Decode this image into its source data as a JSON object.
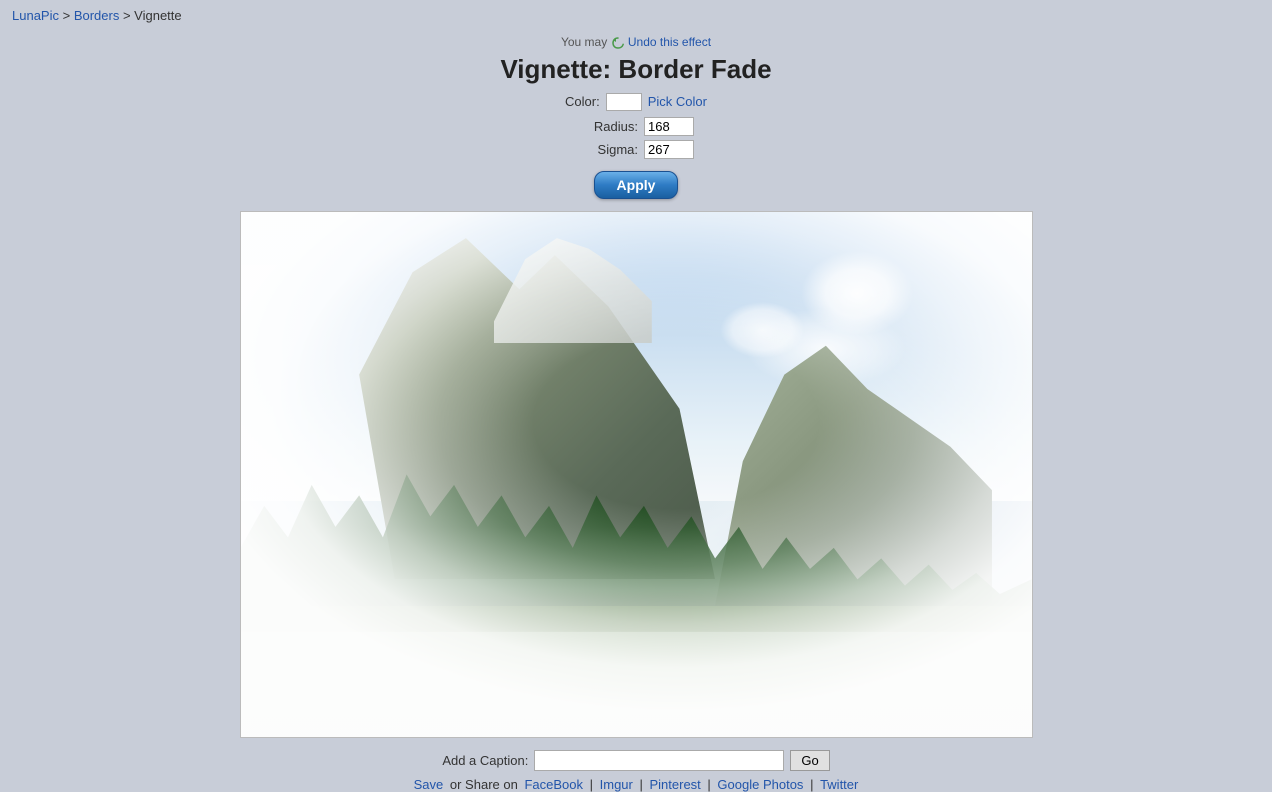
{
  "breadcrumb": {
    "lunapic": "LunaPic",
    "sep1": " > ",
    "borders": "Borders",
    "sep2": " > ",
    "current": "Vignette",
    "lunapic_href": "#",
    "borders_href": "#"
  },
  "undo_line": {
    "text_before": "You may",
    "link_text": "Undo this effect",
    "link_href": "#"
  },
  "title": "Vignette: Border Fade",
  "color": {
    "label": "Color:",
    "pick_label": "Pick Color",
    "value": "#ffffff"
  },
  "radius": {
    "label": "Radius:",
    "value": "168"
  },
  "sigma": {
    "label": "Sigma:",
    "value": "267"
  },
  "apply_button": "Apply",
  "caption": {
    "label": "Add a Caption:",
    "placeholder": "",
    "go_label": "Go"
  },
  "share": {
    "save_label": "Save",
    "text": "or Share on",
    "facebook": "FaceBook",
    "imgur": "Imgur",
    "pinterest": "Pinterest",
    "google_photos": "Google Photos",
    "twitter": "Twitter"
  }
}
